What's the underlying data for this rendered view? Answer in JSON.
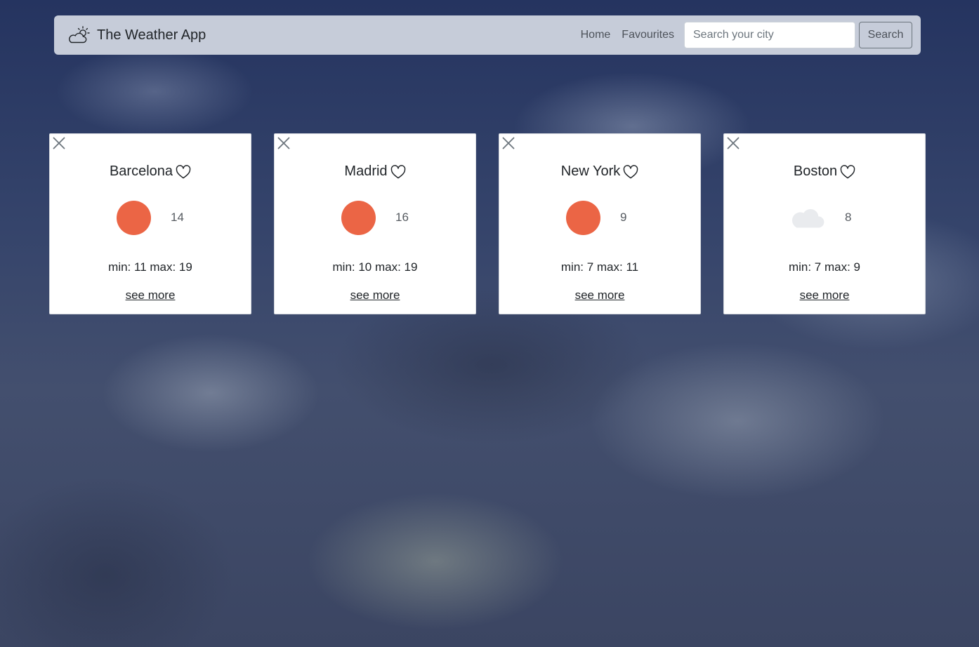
{
  "app": {
    "title": "The Weather App",
    "brand_icon": "cloud-sun-icon"
  },
  "nav": {
    "home_label": "Home",
    "favourites_label": "Favourites",
    "search_placeholder": "Search your city",
    "search_value": "",
    "search_button_label": "Search"
  },
  "colors": {
    "sun": "#eb6545",
    "cloud": "#e9ebee",
    "navbar_bg": "#c6ccd9"
  },
  "cards": [
    {
      "city": "Barcelona",
      "weather_icon": "sun-icon",
      "temp": "14",
      "minmax": "min: 11 max: 19",
      "see_more_label": "see more"
    },
    {
      "city": "Madrid",
      "weather_icon": "sun-icon",
      "temp": "16",
      "minmax": "min: 10 max: 19",
      "see_more_label": "see more"
    },
    {
      "city": "New York",
      "weather_icon": "sun-icon",
      "temp": "9",
      "minmax": "min: 7 max: 11",
      "see_more_label": "see more"
    },
    {
      "city": "Boston",
      "weather_icon": "cloud-icon",
      "temp": "8",
      "minmax": "min: 7 max: 9",
      "see_more_label": "see more"
    }
  ]
}
